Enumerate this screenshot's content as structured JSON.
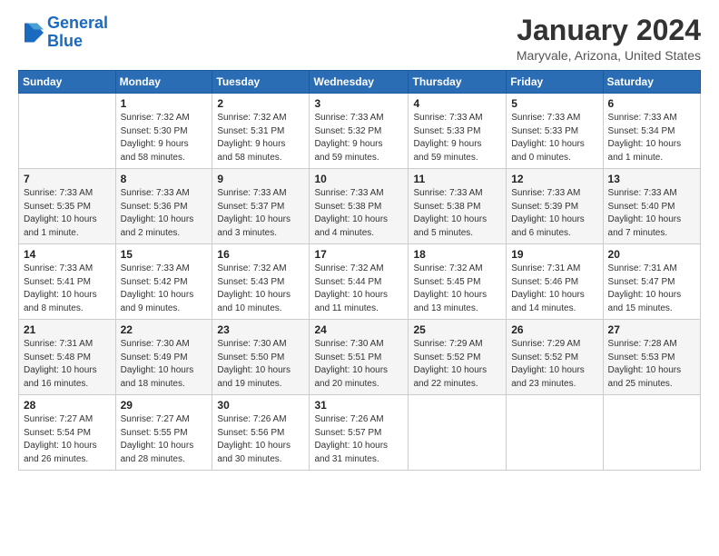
{
  "logo": {
    "text_general": "General",
    "text_blue": "Blue"
  },
  "title": "January 2024",
  "location": "Maryvale, Arizona, United States",
  "days_of_week": [
    "Sunday",
    "Monday",
    "Tuesday",
    "Wednesday",
    "Thursday",
    "Friday",
    "Saturday"
  ],
  "weeks": [
    [
      {
        "day": "",
        "info": ""
      },
      {
        "day": "1",
        "info": "Sunrise: 7:32 AM\nSunset: 5:30 PM\nDaylight: 9 hours\nand 58 minutes."
      },
      {
        "day": "2",
        "info": "Sunrise: 7:32 AM\nSunset: 5:31 PM\nDaylight: 9 hours\nand 58 minutes."
      },
      {
        "day": "3",
        "info": "Sunrise: 7:33 AM\nSunset: 5:32 PM\nDaylight: 9 hours\nand 59 minutes."
      },
      {
        "day": "4",
        "info": "Sunrise: 7:33 AM\nSunset: 5:33 PM\nDaylight: 9 hours\nand 59 minutes."
      },
      {
        "day": "5",
        "info": "Sunrise: 7:33 AM\nSunset: 5:33 PM\nDaylight: 10 hours\nand 0 minutes."
      },
      {
        "day": "6",
        "info": "Sunrise: 7:33 AM\nSunset: 5:34 PM\nDaylight: 10 hours\nand 1 minute."
      }
    ],
    [
      {
        "day": "7",
        "info": "Sunrise: 7:33 AM\nSunset: 5:35 PM\nDaylight: 10 hours\nand 1 minute."
      },
      {
        "day": "8",
        "info": "Sunrise: 7:33 AM\nSunset: 5:36 PM\nDaylight: 10 hours\nand 2 minutes."
      },
      {
        "day": "9",
        "info": "Sunrise: 7:33 AM\nSunset: 5:37 PM\nDaylight: 10 hours\nand 3 minutes."
      },
      {
        "day": "10",
        "info": "Sunrise: 7:33 AM\nSunset: 5:38 PM\nDaylight: 10 hours\nand 4 minutes."
      },
      {
        "day": "11",
        "info": "Sunrise: 7:33 AM\nSunset: 5:38 PM\nDaylight: 10 hours\nand 5 minutes."
      },
      {
        "day": "12",
        "info": "Sunrise: 7:33 AM\nSunset: 5:39 PM\nDaylight: 10 hours\nand 6 minutes."
      },
      {
        "day": "13",
        "info": "Sunrise: 7:33 AM\nSunset: 5:40 PM\nDaylight: 10 hours\nand 7 minutes."
      }
    ],
    [
      {
        "day": "14",
        "info": "Sunrise: 7:33 AM\nSunset: 5:41 PM\nDaylight: 10 hours\nand 8 minutes."
      },
      {
        "day": "15",
        "info": "Sunrise: 7:33 AM\nSunset: 5:42 PM\nDaylight: 10 hours\nand 9 minutes."
      },
      {
        "day": "16",
        "info": "Sunrise: 7:32 AM\nSunset: 5:43 PM\nDaylight: 10 hours\nand 10 minutes."
      },
      {
        "day": "17",
        "info": "Sunrise: 7:32 AM\nSunset: 5:44 PM\nDaylight: 10 hours\nand 11 minutes."
      },
      {
        "day": "18",
        "info": "Sunrise: 7:32 AM\nSunset: 5:45 PM\nDaylight: 10 hours\nand 13 minutes."
      },
      {
        "day": "19",
        "info": "Sunrise: 7:31 AM\nSunset: 5:46 PM\nDaylight: 10 hours\nand 14 minutes."
      },
      {
        "day": "20",
        "info": "Sunrise: 7:31 AM\nSunset: 5:47 PM\nDaylight: 10 hours\nand 15 minutes."
      }
    ],
    [
      {
        "day": "21",
        "info": "Sunrise: 7:31 AM\nSunset: 5:48 PM\nDaylight: 10 hours\nand 16 minutes."
      },
      {
        "day": "22",
        "info": "Sunrise: 7:30 AM\nSunset: 5:49 PM\nDaylight: 10 hours\nand 18 minutes."
      },
      {
        "day": "23",
        "info": "Sunrise: 7:30 AM\nSunset: 5:50 PM\nDaylight: 10 hours\nand 19 minutes."
      },
      {
        "day": "24",
        "info": "Sunrise: 7:30 AM\nSunset: 5:51 PM\nDaylight: 10 hours\nand 20 minutes."
      },
      {
        "day": "25",
        "info": "Sunrise: 7:29 AM\nSunset: 5:52 PM\nDaylight: 10 hours\nand 22 minutes."
      },
      {
        "day": "26",
        "info": "Sunrise: 7:29 AM\nSunset: 5:52 PM\nDaylight: 10 hours\nand 23 minutes."
      },
      {
        "day": "27",
        "info": "Sunrise: 7:28 AM\nSunset: 5:53 PM\nDaylight: 10 hours\nand 25 minutes."
      }
    ],
    [
      {
        "day": "28",
        "info": "Sunrise: 7:27 AM\nSunset: 5:54 PM\nDaylight: 10 hours\nand 26 minutes."
      },
      {
        "day": "29",
        "info": "Sunrise: 7:27 AM\nSunset: 5:55 PM\nDaylight: 10 hours\nand 28 minutes."
      },
      {
        "day": "30",
        "info": "Sunrise: 7:26 AM\nSunset: 5:56 PM\nDaylight: 10 hours\nand 30 minutes."
      },
      {
        "day": "31",
        "info": "Sunrise: 7:26 AM\nSunset: 5:57 PM\nDaylight: 10 hours\nand 31 minutes."
      },
      {
        "day": "",
        "info": ""
      },
      {
        "day": "",
        "info": ""
      },
      {
        "day": "",
        "info": ""
      }
    ]
  ]
}
